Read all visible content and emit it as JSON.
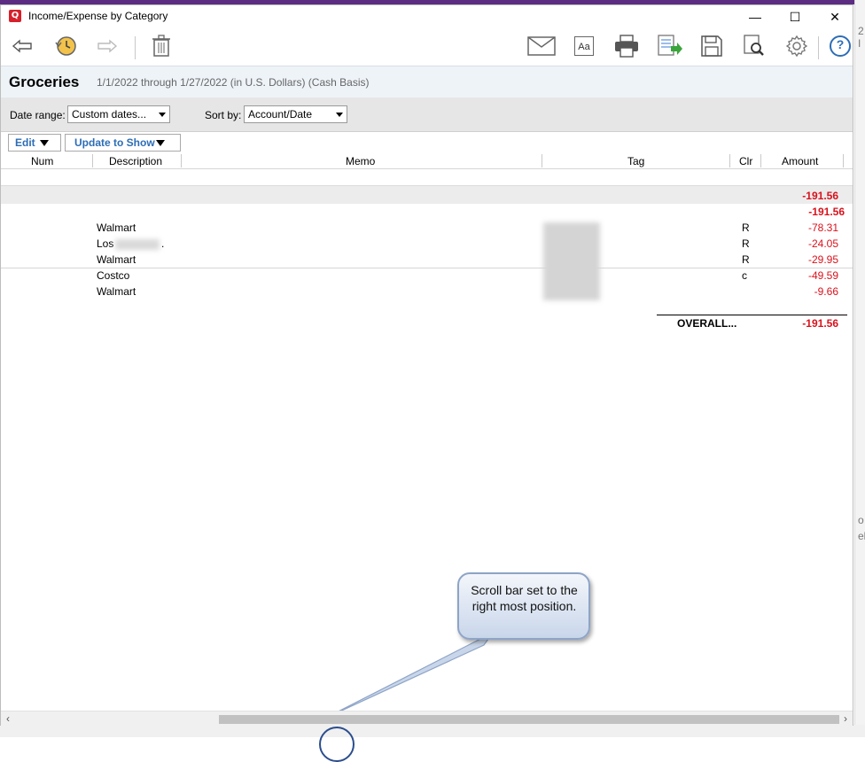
{
  "window": {
    "title": "Income/Expense by Category",
    "app_icon_letter": "Q",
    "controls": {
      "minimize": "—",
      "maximize": "☐",
      "close": "✕"
    }
  },
  "toolbar": {
    "icons": [
      "back-arrow-icon",
      "history-icon",
      "forward-arrow-icon",
      "trash-icon",
      "email-icon",
      "font-icon",
      "print-icon",
      "export-icon",
      "save-icon",
      "find-icon",
      "gear-icon",
      "help-icon"
    ],
    "font_icon_text": "Aa",
    "help_icon_text": "?"
  },
  "report": {
    "category": "Groceries",
    "range_text": "1/1/2022 through 1/27/2022 (in U.S. Dollars) (Cash Basis)"
  },
  "filters": {
    "date_range_label": "Date range:",
    "date_range_value": "Custom dates...",
    "sort_by_label": "Sort by:",
    "sort_by_value": "Account/Date"
  },
  "actions": {
    "edit_label": "Edit",
    "update_label": "Update to Show"
  },
  "columns": [
    "Num",
    "Description",
    "Memo",
    "Tag",
    "Clr",
    "Amount"
  ],
  "group_total": "-191.56",
  "subtotal": "-191.56",
  "rows": [
    {
      "description": "Walmart",
      "clr": "R",
      "amount": "-78.31"
    },
    {
      "description": "Los",
      "description_suffix": ".",
      "clr": "R",
      "amount": "-24.05"
    },
    {
      "description": "Walmart",
      "clr": "R",
      "amount": "-29.95"
    },
    {
      "description": "Costco",
      "clr": "c",
      "amount": "-49.59"
    },
    {
      "description": "Walmart",
      "clr": "",
      "amount": "-9.66"
    }
  ],
  "overall": {
    "label": "OVERALL...",
    "amount": "-191.56"
  },
  "callout": {
    "text": "Scroll bar set to the right most position."
  },
  "background_fragments": {
    "right_1": "2 I",
    "right_2": "o",
    "right_3": "el"
  },
  "colors": {
    "negative": "#d9111b",
    "link_blue": "#2c6db5",
    "header_bg": "#eef3f8"
  }
}
